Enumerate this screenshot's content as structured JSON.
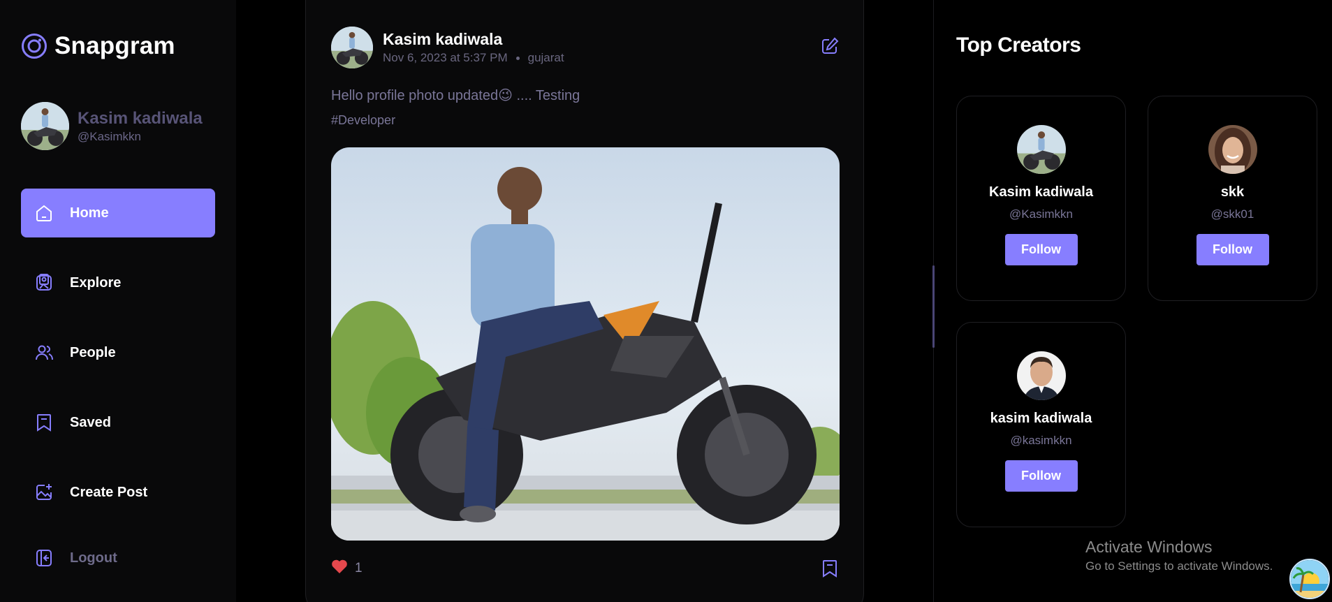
{
  "app": {
    "name": "Snapgram",
    "accent": "#877eff"
  },
  "profile": {
    "name": "Kasim kadiwala",
    "handle": "@Kasimkkn"
  },
  "nav": {
    "items": [
      {
        "label": "Home",
        "icon": "home-icon",
        "active": true
      },
      {
        "label": "Explore",
        "icon": "explore-icon",
        "active": false
      },
      {
        "label": "People",
        "icon": "people-icon",
        "active": false
      },
      {
        "label": "Saved",
        "icon": "bookmark-icon",
        "active": false
      },
      {
        "label": "Create Post",
        "icon": "create-post-icon",
        "active": false
      }
    ],
    "logout": {
      "label": "Logout",
      "icon": "logout-icon"
    }
  },
  "post": {
    "author": "Kasim kadiwala",
    "date": "Nov 6, 2023 at 5:37 PM",
    "location": "gujarat",
    "caption": "Hello profile photo updated😉 .... Testing",
    "hashtags": "#Developer",
    "likes": "1",
    "liked": true,
    "like_color": "#e5484d"
  },
  "top_creators": {
    "title": "Top Creators",
    "creators": [
      {
        "name": "Kasim kadiwala",
        "handle": "@Kasimkkn",
        "button": "Follow"
      },
      {
        "name": "skk",
        "handle": "@skk01",
        "button": "Follow"
      },
      {
        "name": "kasim kadiwala",
        "handle": "@kasimkkn",
        "button": "Follow"
      }
    ]
  },
  "watermark": {
    "title": "Activate Windows",
    "subtitle": "Go to Settings to activate Windows."
  }
}
